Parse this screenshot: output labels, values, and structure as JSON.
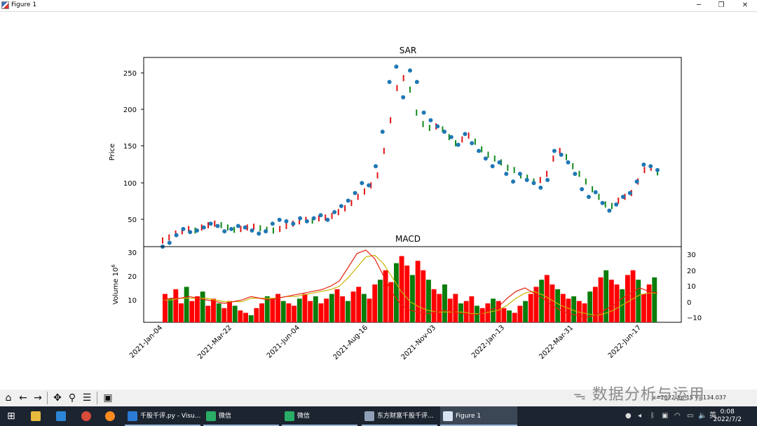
{
  "window": {
    "title": "Figure 1",
    "minimize_icon": "─",
    "maximize_icon": "❐",
    "close_icon": "✕"
  },
  "charts": {
    "top": {
      "title": "SAR",
      "ylabel": "Price",
      "yticks": [
        "50",
        "100",
        "150",
        "200",
        "250"
      ]
    },
    "bottom": {
      "title": "MACD",
      "ylabel_main": "Volume 10",
      "ylabel_sup": "6",
      "yticks_left": [
        "10",
        "20",
        "30"
      ],
      "yticks_right": [
        "30",
        "20",
        "10",
        "0",
        "−10"
      ]
    },
    "xticks": [
      "2021-Jan-04",
      "2021-Mar-22",
      "2021-Jun-04",
      "2021-Aug-16",
      "2021-Nov-03",
      "2022-Jan-13",
      "2022-Mar-31",
      "2022-Jun-17"
    ]
  },
  "chart_data": [
    {
      "type": "line",
      "title": "SAR",
      "ylabel": "Price",
      "ylim": [
        25,
        272
      ],
      "series": [
        {
          "values": [
            33,
            37,
            42,
            45,
            48,
            46,
            50,
            53,
            55,
            53,
            50,
            47,
            48,
            50,
            51,
            49,
            47,
            46,
            48,
            52,
            55,
            58,
            60,
            59,
            62,
            63,
            65,
            70,
            75,
            82,
            90,
            97,
            105,
            118,
            150,
            190,
            232,
            245,
            230,
            200,
            185,
            180,
            182,
            178,
            168,
            160,
            165,
            170,
            162,
            152,
            145,
            140,
            135,
            128,
            125,
            118,
            115,
            110,
            112,
            120,
            140,
            150,
            142,
            130,
            120,
            110,
            100,
            90,
            80,
            78,
            85,
            90,
            95,
            110,
            125,
            128,
            122
          ]
        },
        {
          "values": [
            25,
            30,
            40,
            48,
            44,
            46,
            50,
            55,
            52,
            45,
            48,
            52,
            50,
            46,
            42,
            45,
            55,
            60,
            58,
            55,
            62,
            58,
            62,
            66,
            60,
            70,
            78,
            85,
            95,
            108,
            105,
            130,
            175,
            240,
            260,
            220,
            255,
            240,
            200,
            190,
            182,
            175,
            168,
            158,
            172,
            160,
            150,
            140,
            130,
            135,
            120,
            110,
            120,
            112,
            108,
            102,
            112,
            150,
            145,
            135,
            120,
            100,
            90,
            96,
            82,
            72,
            80,
            90,
            95,
            110,
            132,
            130,
            125
          ]
        }
      ]
    },
    {
      "type": "bar",
      "title": "MACD",
      "ylabel": "Volume 10^6",
      "ylim": [
        0,
        32
      ],
      "values": [
        12,
        10,
        14,
        8,
        15,
        9,
        11,
        13,
        7,
        10,
        8,
        6,
        9,
        7,
        5,
        4,
        3,
        6,
        8,
        11,
        10,
        12,
        9,
        8,
        7,
        10,
        12,
        9,
        11,
        8,
        10,
        12,
        14,
        11,
        9,
        13,
        15,
        12,
        10,
        16,
        18,
        22,
        17,
        25,
        28,
        24,
        20,
        26,
        22,
        18,
        14,
        12,
        16,
        10,
        12,
        8,
        9,
        11,
        7,
        6,
        8,
        10,
        9,
        6,
        5,
        4,
        7,
        9,
        12,
        15,
        18,
        20,
        16,
        14,
        12,
        10,
        11,
        9,
        8,
        13,
        15,
        19,
        22,
        18,
        16,
        14,
        20,
        22,
        18,
        12,
        16,
        19
      ],
      "macd": [
        1,
        2,
        2,
        3,
        2,
        1,
        0,
        -1,
        0,
        1,
        3,
        2,
        1,
        2,
        3,
        4,
        5,
        6,
        7,
        9,
        12,
        20,
        28,
        30,
        25,
        15,
        5,
        -2,
        -5,
        -6,
        -7,
        -6,
        -5,
        -6,
        -7,
        -8,
        -7,
        -5,
        -3,
        2,
        6,
        8,
        5,
        2,
        -2,
        -5,
        -7,
        -8,
        -9,
        -8,
        -5,
        -2,
        2,
        5,
        8,
        6,
        5
      ],
      "signal": [
        1,
        1,
        2,
        2,
        2,
        2,
        1,
        0,
        0,
        0,
        2,
        2,
        2,
        2,
        3,
        3,
        4,
        5,
        6,
        7,
        9,
        14,
        20,
        26,
        27,
        22,
        14,
        6,
        0,
        -3,
        -5,
        -6,
        -6,
        -6,
        -6,
        -7,
        -7,
        -6,
        -5,
        -2,
        2,
        5,
        6,
        4,
        1,
        -2,
        -4,
        -6,
        -7,
        -8,
        -7,
        -5,
        -2,
        1,
        4,
        5,
        5
      ],
      "right_ylim": [
        -12,
        32
      ]
    }
  ],
  "toolbar": {
    "coords": "x=2022-Jul-15  y=134.037"
  },
  "watermark": "数据分析与运用",
  "taskbar": {
    "items": [
      {
        "label": "千股千评.py - Visu...",
        "color": "#2b7bd6"
      },
      {
        "label": "微信",
        "color": "#2aae67"
      },
      {
        "label": "微信",
        "color": "#2aae67"
      },
      {
        "label": "东方财富千股千评...",
        "color": "#8fa0b6"
      },
      {
        "label": "Figure 1",
        "color": "#d9e4f2"
      }
    ],
    "ime": "英",
    "time": "0:08",
    "date": "2022/7/2"
  }
}
